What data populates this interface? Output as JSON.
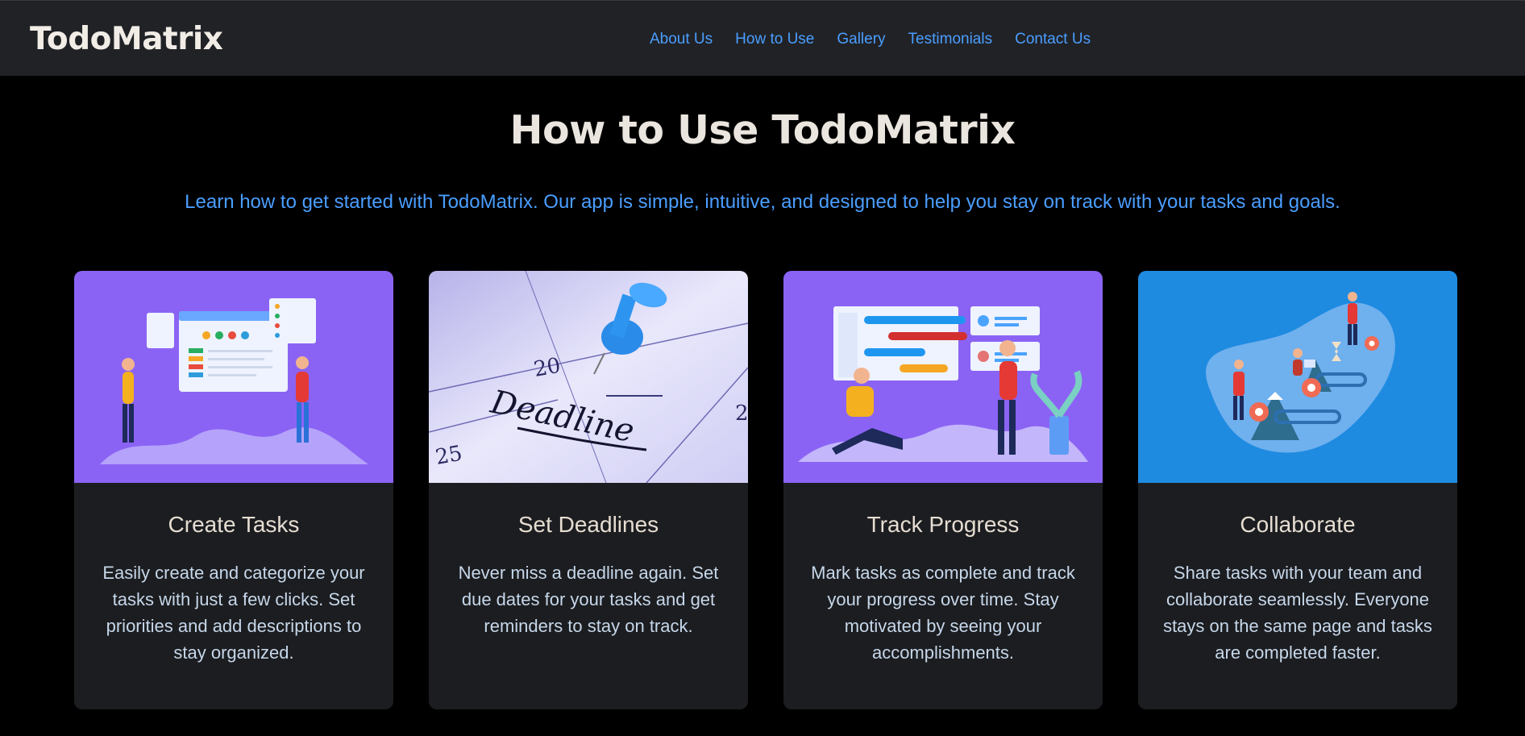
{
  "brand": "TodoMatrix",
  "nav": [
    "About Us",
    "How to Use",
    "Gallery",
    "Testimonials",
    "Contact Us"
  ],
  "title": "How to Use TodoMatrix",
  "intro": "Learn how to get started with TodoMatrix. Our app is simple, intuitive, and designed to help you stay on track with your tasks and goals.",
  "cards": [
    {
      "title": "Create Tasks",
      "text": "Easily create and categorize your tasks with just a few clicks. Set priorities and add descriptions to stay organized.",
      "image_bg": "#8b63f4"
    },
    {
      "title": "Set Deadlines",
      "text": "Never miss a deadline again. Set due dates for your tasks and get reminders to stay on track.",
      "image_text": [
        "20",
        "25",
        "2",
        "Deadline"
      ],
      "image_bg": "#dcd9f7"
    },
    {
      "title": "Track Progress",
      "text": "Mark tasks as complete and track your progress over time. Stay motivated by seeing your accomplishments.",
      "image_bg": "#8b63f4"
    },
    {
      "title": "Collaborate",
      "text": "Share tasks with your team and collaborate seamlessly. Everyone stays on the same page and tasks are completed faster.",
      "image_bg": "#1e8be1"
    }
  ],
  "colors": {
    "link": "#4a9eff",
    "topbar": "#212226",
    "card": "#1c1d20",
    "page_bg": "#000000"
  }
}
